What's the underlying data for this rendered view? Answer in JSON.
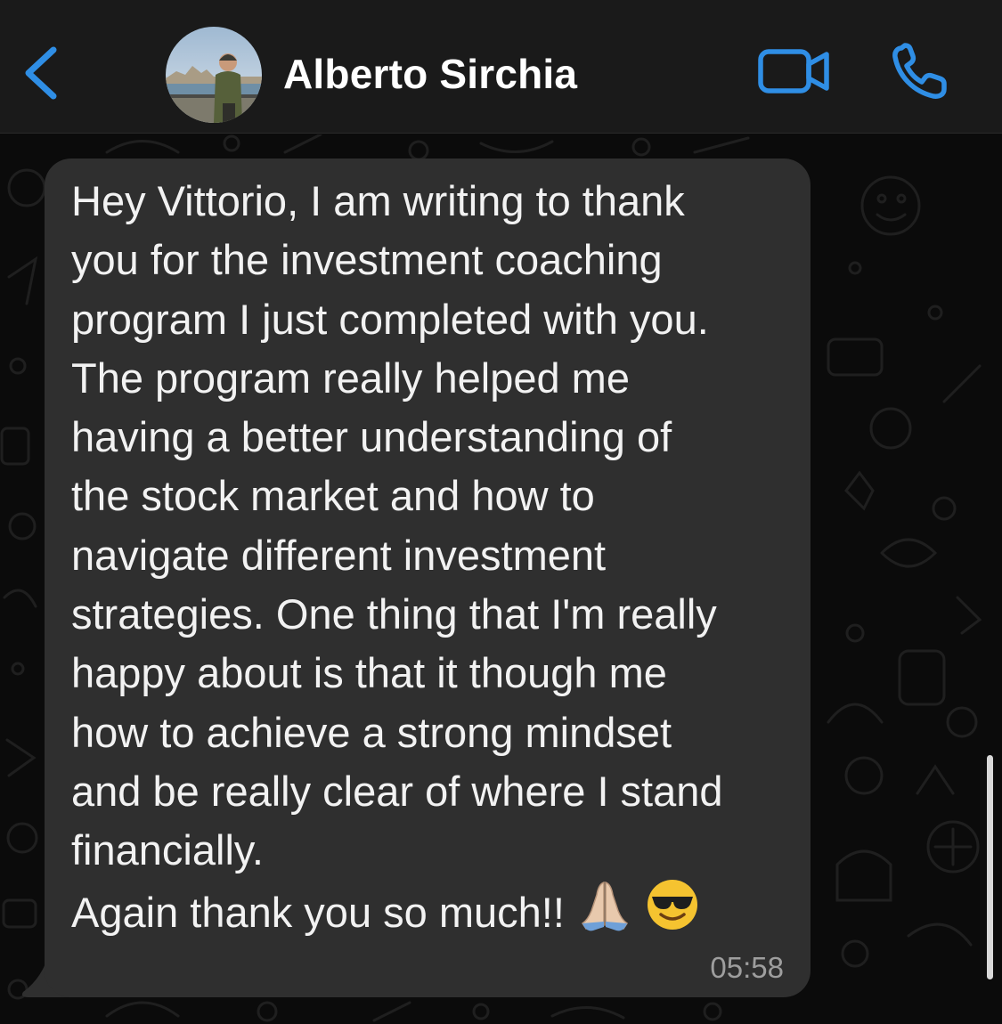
{
  "header": {
    "contact_name": "Alberto Sirchia",
    "back_icon": "chevron-left-icon",
    "video_icon": "video-camera-icon",
    "call_icon": "phone-icon"
  },
  "message": {
    "lines": [
      "Hey Vittorio, I am writing to thank",
      "you for the investment coaching",
      "program I just completed with you.",
      "The program really helped me",
      "having a better understanding of",
      "the stock market and how to",
      "navigate different investment",
      "strategies. One thing that I'm really",
      "happy about is that it though me",
      "how to achieve a strong mindset",
      "and be really clear of where I stand",
      "financially.",
      "Again thank you so much!!"
    ],
    "emojis": [
      "folded-hands-emoji",
      "smiling-face-with-sunglasses-emoji"
    ],
    "time": "05:58"
  },
  "colors": {
    "accent": "#2f8ee5",
    "header_bg": "#1a1a1a",
    "chat_bg": "#0b0b0b",
    "bubble_bg": "#2f2f2f",
    "text": "#f2f2f2",
    "timestamp": "#9e9e9e"
  }
}
